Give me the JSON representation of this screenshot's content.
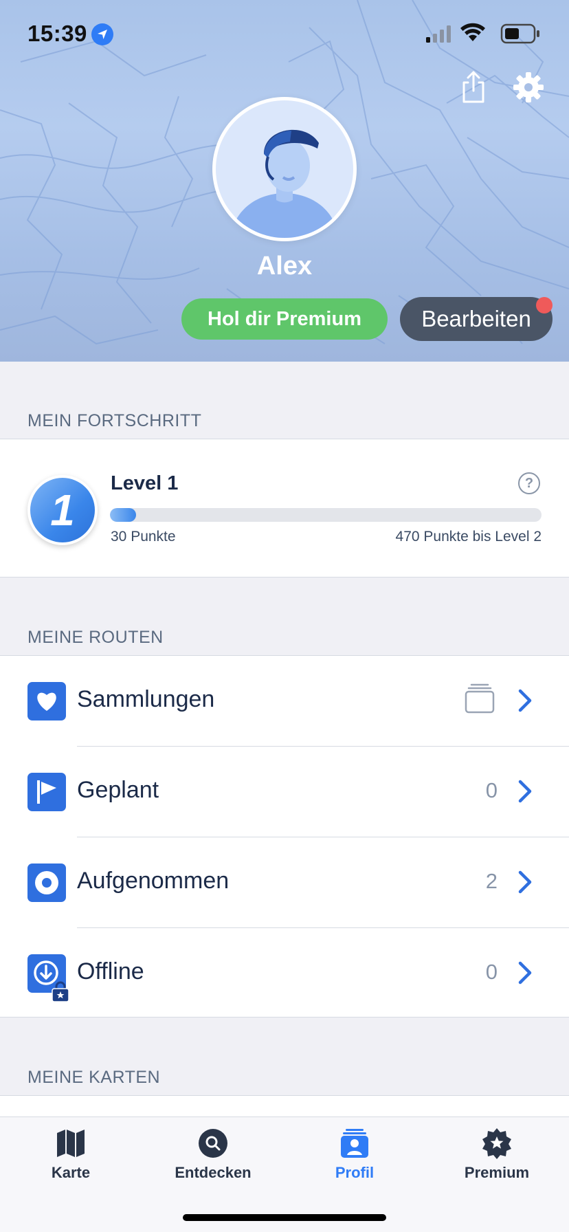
{
  "status_bar": {
    "time": "15:39"
  },
  "header": {
    "icons": [
      "share-icon",
      "gear-icon"
    ],
    "user_name": "Alex",
    "premium_button": "Hol dir Premium",
    "edit_button": "Bearbeiten"
  },
  "progress": {
    "section_title": "MEIN FORTSCHRITT",
    "badge_number": "1",
    "level_title": "Level 1",
    "points": "30 Punkte",
    "points_to_next": "470 Punkte bis Level 2",
    "progress_fraction": 0.06
  },
  "routes": {
    "section_title": "MEINE ROUTEN",
    "items": [
      {
        "label": "Sammlungen",
        "icon": "heart-icon",
        "count": ""
      },
      {
        "label": "Geplant",
        "icon": "flag-icon",
        "count": "0"
      },
      {
        "label": "Aufgenommen",
        "icon": "record-icon",
        "count": "2"
      },
      {
        "label": "Offline",
        "icon": "download-icon",
        "count": "0"
      }
    ]
  },
  "maps": {
    "section_title": "MEINE KARTEN"
  },
  "tabbar": {
    "tabs": [
      {
        "label": "Karte",
        "icon": "map-icon"
      },
      {
        "label": "Entdecken",
        "icon": "search-icon"
      },
      {
        "label": "Profil",
        "icon": "profile-icon",
        "active": true
      },
      {
        "label": "Premium",
        "icon": "premium-star-icon"
      }
    ]
  },
  "colors": {
    "accent": "#2f7cf6",
    "premium_green": "#5fc66a",
    "notification": "#ef5a5a"
  }
}
